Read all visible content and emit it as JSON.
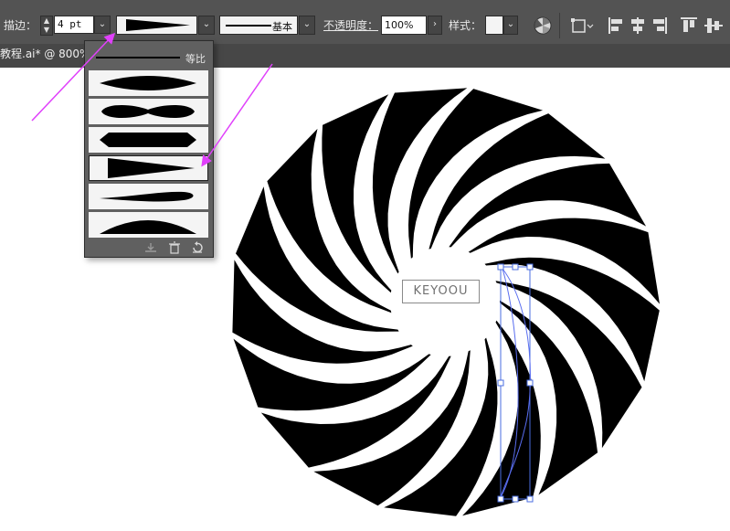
{
  "toolbar": {
    "stroke_label": "描边：",
    "stroke_weight": "4 pt",
    "brush_label": "基本",
    "opacity_label": "不透明度：",
    "opacity_value": "100%",
    "style_label": "样式："
  },
  "document_tab": {
    "title": "教程.ai* @ 800%"
  },
  "profile_dropdown": {
    "uniform_label": "等比",
    "profiles": [
      "width-profile-1",
      "width-profile-2",
      "width-profile-3",
      "width-profile-4",
      "width-profile-5",
      "width-profile-6"
    ],
    "selected_index": 3
  },
  "watermark": {
    "text": "KEYOOU"
  },
  "colors": {
    "toolbar_bg": "#535353",
    "annotation_arrow": "#e040fb",
    "selection": "#4a6ee0"
  },
  "icons": [
    "stroke-stepper-icon",
    "chevron-down-icon",
    "brush-icon",
    "chevron-right-icon",
    "recolor-icon",
    "transform-icon",
    "align-left-icon",
    "align-center-icon",
    "align-right-icon",
    "align-top-icon",
    "align-vcenter-icon",
    "save-profile-icon",
    "delete-profile-icon",
    "reset-profile-icon"
  ]
}
